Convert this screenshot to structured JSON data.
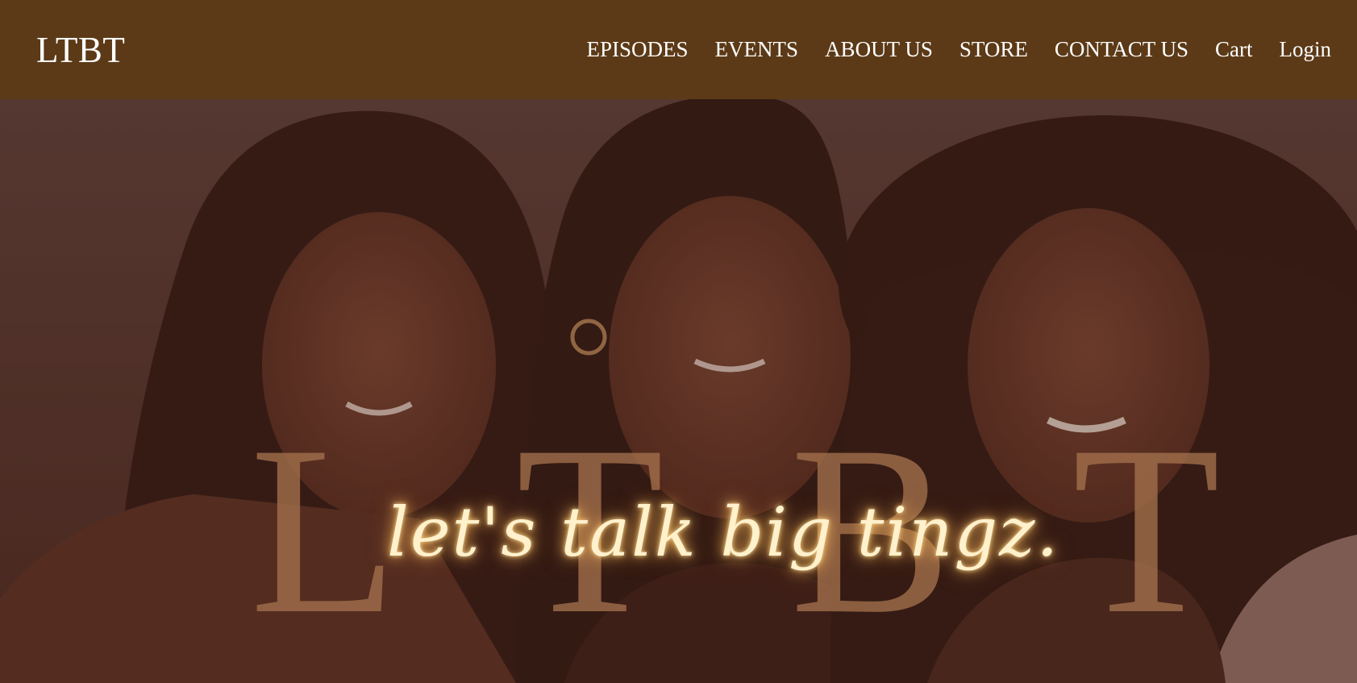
{
  "brand": {
    "logo_text": "LTBT"
  },
  "nav": {
    "items": [
      {
        "label": "EPISODES"
      },
      {
        "label": "EVENTS"
      },
      {
        "label": "ABOUT US"
      },
      {
        "label": "STORE"
      },
      {
        "label": "CONTACT US"
      },
      {
        "label": "Cart"
      },
      {
        "label": "Login"
      }
    ]
  },
  "hero": {
    "letters": [
      "L",
      "T",
      "B",
      "T"
    ],
    "tagline": "let's talk big tingz."
  },
  "colors": {
    "header_bg": "#5c3a17",
    "hero_letters": "#a4714d",
    "tagline_glow": "#ffd98f"
  }
}
